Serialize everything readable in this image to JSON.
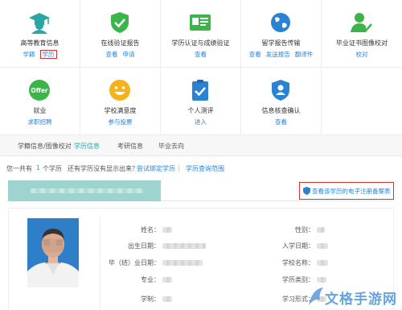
{
  "services": [
    {
      "title": "高等教育信息",
      "icon": "graduate-icon",
      "links": [
        {
          "label": "学籍",
          "boxed": false
        },
        {
          "label": "学历",
          "boxed": true
        }
      ]
    },
    {
      "title": "在线验证报告",
      "icon": "shield-check-icon",
      "links": [
        {
          "label": "查看",
          "boxed": false
        },
        {
          "label": "申请",
          "boxed": false
        }
      ]
    },
    {
      "title": "学历认证与成绩验证",
      "icon": "certificate-icon",
      "links": [
        {
          "label": "查看",
          "boxed": false
        }
      ]
    },
    {
      "title": "留学报告传输",
      "icon": "globe-icon",
      "links": [
        {
          "label": "查看",
          "boxed": false
        },
        {
          "label": "发送报告",
          "boxed": false
        },
        {
          "label": "翻译件",
          "boxed": false
        }
      ]
    },
    {
      "title": "毕业证书图像校对",
      "icon": "person-check-icon",
      "links": [
        {
          "label": "校对",
          "boxed": false
        }
      ]
    },
    {
      "title": "就业",
      "icon": "offer-icon",
      "icon_text": "Offer",
      "links": [
        {
          "label": "求职招聘",
          "boxed": false
        }
      ]
    },
    {
      "title": "学校满意度",
      "icon": "smiley-icon",
      "links": [
        {
          "label": "参与投票",
          "boxed": false
        }
      ]
    },
    {
      "title": "个人测评",
      "icon": "clipboard-check-icon",
      "links": [
        {
          "label": "进入",
          "boxed": false
        }
      ]
    },
    {
      "title": "信息核查确认",
      "icon": "person-shield-icon",
      "links": [
        {
          "label": "查看",
          "boxed": false
        }
      ]
    }
  ],
  "tabs": [
    {
      "label": "学籍信息/图像校对",
      "active": false
    },
    {
      "label": "学历信息",
      "active": true
    },
    {
      "label": "考研信息",
      "active": false
    },
    {
      "label": "毕业去向",
      "active": false
    }
  ],
  "count_row": {
    "prefix": "您一共有",
    "count": "1",
    "suffix": "个学历",
    "question": "还有学历没有显示出来？",
    "bind_link": "尝试绑定学历",
    "sep": "|",
    "scope_link": "学历查询范围"
  },
  "filing_button": "查看该学历的电子注册备案表",
  "fields_left": [
    "姓名：",
    "出生日期：",
    "毕（结）业日期：",
    "专业：",
    "学制："
  ],
  "fields_right": [
    "性别：",
    "入学日期：",
    "学校名称：",
    "学历类别：",
    "学习形式："
  ],
  "watermark": "文格手游网",
  "colors": {
    "accent": "#2aa6a6",
    "link": "#2b82d3",
    "highlight_box": "#d0342c",
    "bar": "#9ed4d0"
  }
}
